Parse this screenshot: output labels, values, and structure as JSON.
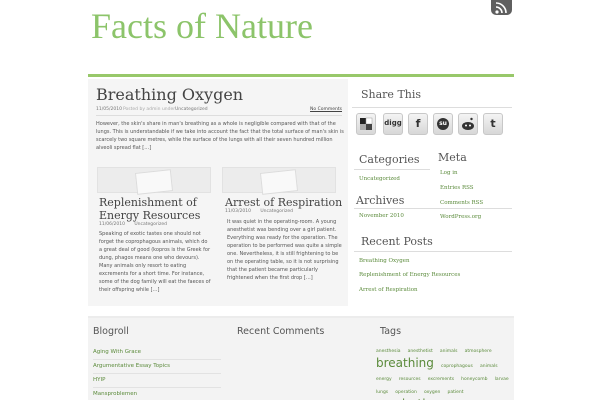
{
  "site": {
    "title": "Facts of Nature"
  },
  "post": {
    "title": "Breathing Oxygen",
    "date": "11/05/2010",
    "author_line": "Posted by admin under",
    "category": "Uncategorized",
    "comments": "No Comments",
    "excerpt": "However, the skin's share in man's breathing as a whole is negligible compared with that of the lungs. This is understandable if we take into account the fact that the total surface of man's skin is scarcely two square metres, while the surface of the lungs with all their seven hundred million alveoli spread flat […]"
  },
  "cards": [
    {
      "title": "Replenishment of Energy Resources",
      "date": "11/06/2010",
      "category": "Uncategorized",
      "text": "Speaking of exotic tastes one should not forget the coprophagous animals, which do a great deal of good (kopros is the Greek for dung, phagos means one who devours). Many animals only resort to eating excrements for a short time. For instance, some of the dog family will eat the faeces of their offspring while […]"
    },
    {
      "title": "Arrest of Respiration",
      "date": "11/03/2010",
      "category": "Uncategorized",
      "text": "It was quiet in the operating-room. A young anesthetist was bending over a girl patient. Everything was ready for the operation. The operation to be performed was quite a simple one. Nevertheless, it is still frightening to be on the operating table, so it is not surprising that the patient became particularly frightened when the first drop […]"
    }
  ],
  "sidebar": {
    "share_title": "Share This",
    "share_buttons": [
      {
        "name": "delicious",
        "icon": "delicious-icon",
        "label": ""
      },
      {
        "name": "digg",
        "icon": "digg-icon",
        "label": "digg"
      },
      {
        "name": "facebook",
        "icon": "facebook-icon",
        "label": "f"
      },
      {
        "name": "stumbleupon",
        "icon": "stumbleupon-icon",
        "label": "su"
      },
      {
        "name": "reddit",
        "icon": "reddit-icon",
        "label": ""
      },
      {
        "name": "twitter",
        "icon": "twitter-icon",
        "label": "t"
      }
    ],
    "categories_title": "Categories",
    "categories": [
      "Uncategorized"
    ],
    "meta_title": "Meta",
    "meta_links": [
      "Log in",
      "Entries RSS",
      "Comments RSS",
      "WordPress.org"
    ],
    "archives_title": "Archives",
    "archives": [
      "November 2010"
    ],
    "recent_title": "Recent Posts",
    "recent_posts": [
      "Breathing Oxygen",
      "Replenishment of Energy Resources",
      "Arrest of Respiration"
    ]
  },
  "footer": {
    "blogroll_title": "Blogroll",
    "blogroll": [
      "Aging With Grace",
      "Argumentative Essay Topics",
      "HYIP",
      "Mansproblemen"
    ],
    "recent_comments_title": "Recent Comments",
    "tags_title": "Tags",
    "tags": [
      {
        "text": "anesthesia",
        "size": "s"
      },
      {
        "text": "anesthetist",
        "size": "s"
      },
      {
        "text": "animals",
        "size": "s"
      },
      {
        "text": "atmosphere",
        "size": "s"
      },
      {
        "text": "breathing",
        "size": "l"
      },
      {
        "text": "coprophagous",
        "size": "s"
      },
      {
        "text": "animals",
        "size": "s"
      },
      {
        "text": "energy",
        "size": "s"
      },
      {
        "text": "resources",
        "size": "s"
      },
      {
        "text": "excrements",
        "size": "s"
      },
      {
        "text": "honeycomb",
        "size": "s"
      },
      {
        "text": "larvae",
        "size": "s"
      },
      {
        "text": "lungs",
        "size": "s"
      },
      {
        "text": "operation",
        "size": "s"
      },
      {
        "text": "oxygen",
        "size": "s"
      },
      {
        "text": "patient",
        "size": "s"
      },
      {
        "text": "respiration",
        "size": "l"
      }
    ]
  },
  "colors": {
    "accent": "#8cc46a",
    "link": "#5a8a3a"
  }
}
